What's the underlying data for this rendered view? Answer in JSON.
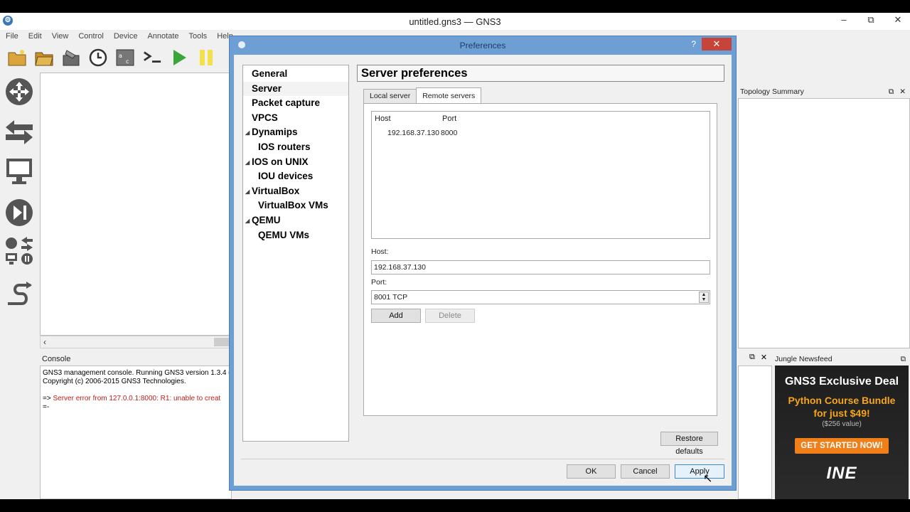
{
  "window": {
    "title": "untitled.gns3 — GNS3",
    "controls": {
      "minimize": "–",
      "restore": "⧉",
      "close": "✕"
    }
  },
  "menu": [
    "File",
    "Edit",
    "View",
    "Control",
    "Device",
    "Annotate",
    "Tools",
    "Help"
  ],
  "toolbar": {
    "icons": [
      "new-project-icon",
      "open-project-icon",
      "save-project-icon",
      "snapshot-icon",
      "screenshot-icon",
      "console-all-icon",
      "start-all-icon",
      "suspend-all-icon"
    ]
  },
  "left_dock": {
    "icons": [
      "router-icon",
      "switch-icon",
      "end-device-icon",
      "security-device-icon",
      "all-devices-icon",
      "add-link-icon"
    ]
  },
  "console": {
    "title": "Console",
    "lines": [
      "GNS3 management console. Running GNS3 version 1.3.4 o",
      "Copyright (c) 2006-2015 GNS3 Technologies."
    ],
    "prompt": "=>",
    "error": "Server error from 127.0.0.1:8000: R1: unable to creat",
    "cursor_line": "=-"
  },
  "topology": {
    "title": "Topology Summary"
  },
  "newsfeed": {
    "title": "Jungle Newsfeed",
    "ad": {
      "headline": "GNS3 Exclusive Deal",
      "offer_line1": "Python Course Bundle",
      "offer_line2": "for just $49!",
      "value": "($256 value)",
      "cta": "GET STARTED NOW!",
      "logo": "INE"
    }
  },
  "dialog": {
    "title": "Preferences",
    "help": "?",
    "close": "✕",
    "nav": [
      {
        "label": "General",
        "level": 0
      },
      {
        "label": "Server",
        "level": 0
      },
      {
        "label": "Packet capture",
        "level": 0
      },
      {
        "label": "VPCS",
        "level": 0
      },
      {
        "label": "Dynamips",
        "level": 0,
        "expanded": true
      },
      {
        "label": "IOS routers",
        "level": 1
      },
      {
        "label": "IOS on UNIX",
        "level": 0,
        "expanded": true
      },
      {
        "label": "IOU devices",
        "level": 1
      },
      {
        "label": "VirtualBox",
        "level": 0,
        "expanded": true
      },
      {
        "label": "VirtualBox VMs",
        "level": 1
      },
      {
        "label": "QEMU",
        "level": 0,
        "expanded": true
      },
      {
        "label": "QEMU VMs",
        "level": 1
      }
    ],
    "section_title": "Server preferences",
    "tabs": {
      "local": "Local server",
      "remote": "Remote servers"
    },
    "server_list": {
      "columns": [
        "Host",
        "Port"
      ],
      "rows": [
        {
          "host": "192.168.37.130",
          "port": "8000"
        }
      ]
    },
    "host_label": "Host:",
    "host_value": "192.168.37.130",
    "port_label": "Port:",
    "port_value": "8001 TCP",
    "add": "Add",
    "delete": "Delete",
    "restore": "Restore defaults",
    "ok": "OK",
    "cancel": "Cancel",
    "apply": "Apply"
  }
}
